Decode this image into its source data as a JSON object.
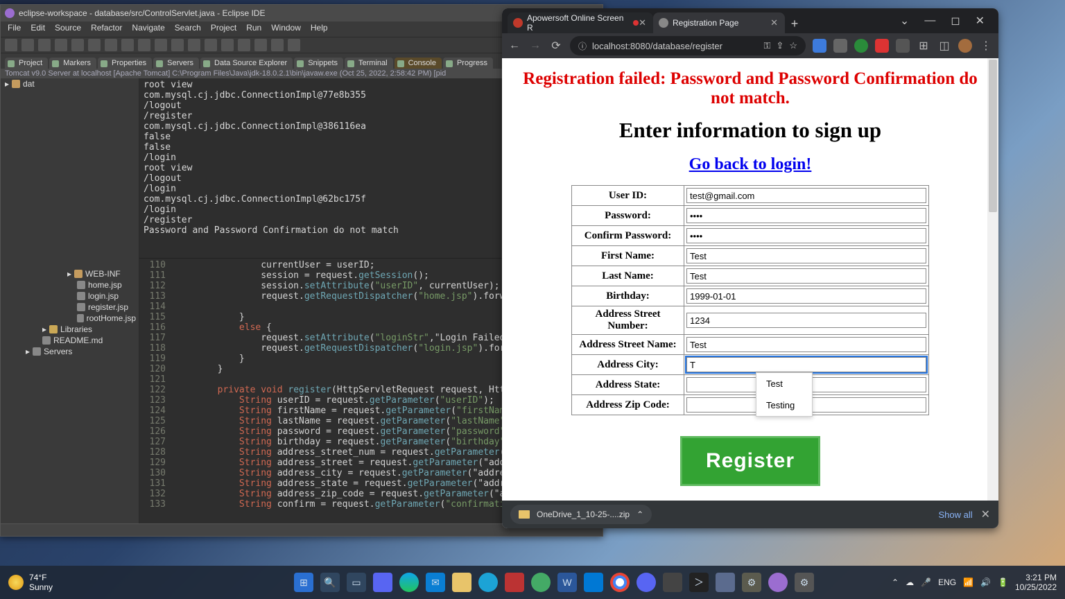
{
  "taskbar": {
    "weather_temp": "74°F",
    "weather_cond": "Sunny",
    "time": "3:21 PM",
    "date": "10/25/2022"
  },
  "eclipse": {
    "title": "eclipse-workspace - database/src/ControlServlet.java - Eclipse IDE",
    "menu": [
      "File",
      "Edit",
      "Source",
      "Refactor",
      "Navigate",
      "Search",
      "Project",
      "Run",
      "Window",
      "Help"
    ],
    "view_tabs": [
      "Project",
      "Markers",
      "Properties",
      "Servers",
      "Data Source Explorer",
      "Snippets",
      "Terminal",
      "Console",
      "Progress"
    ],
    "active_view_tab": "Console",
    "console_header": "Tomcat v9.0 Server at localhost [Apache Tomcat] C:\\Program Files\\Java\\jdk-18.0.2.1\\bin\\javaw.exe (Oct 25, 2022, 2:58:42 PM) [pid",
    "console_lines": [
      "root view",
      "com.mysql.cj.jdbc.ConnectionImpl@77e8b355",
      "/logout",
      "/register",
      "com.mysql.cj.jdbc.ConnectionImpl@386116ea",
      "false",
      "false",
      "/login",
      "root view",
      "/logout",
      "/login",
      "com.mysql.cj.jdbc.ConnectionImpl@62bc175f",
      "/login",
      "/register",
      "Password and Password Confirmation do not match"
    ],
    "explorer_top": [
      "dat"
    ],
    "explorer_files": [
      "WEB-INF",
      "home.jsp",
      "login.jsp",
      "register.jsp",
      "rootHome.jsp",
      "Libraries",
      "README.md",
      "Servers"
    ],
    "code_lines": [
      {
        "n": 110,
        "t": "                currentUser = userID;"
      },
      {
        "n": 111,
        "t": "                session = request.getSession();"
      },
      {
        "n": 112,
        "t": "                session.setAttribute(\"userID\", currentUser);"
      },
      {
        "n": 113,
        "t": "                request.getRequestDispatcher(\"home.jsp\").forwar"
      },
      {
        "n": 114,
        "t": ""
      },
      {
        "n": 115,
        "t": "            }"
      },
      {
        "n": 116,
        "t": "            else {"
      },
      {
        "n": 117,
        "t": "                request.setAttribute(\"loginStr\",\"Login Failed: "
      },
      {
        "n": 118,
        "t": "                request.getRequestDispatcher(\"login.jsp\").forwa"
      },
      {
        "n": 119,
        "t": "            }"
      },
      {
        "n": 120,
        "t": "        }"
      },
      {
        "n": 121,
        "t": ""
      },
      {
        "n": 122,
        "t": "        private void register(HttpServletRequest request, HttpSe"
      },
      {
        "n": 123,
        "t": "            String userID = request.getParameter(\"userID\");"
      },
      {
        "n": 124,
        "t": "            String firstName = request.getParameter(\"firstName\")"
      },
      {
        "n": 125,
        "t": "            String lastName = request.getParameter(\"lastName\");"
      },
      {
        "n": 126,
        "t": "            String password = request.getParameter(\"password\");"
      },
      {
        "n": 127,
        "t": "            String birthday = request.getParameter(\"birthday\");"
      },
      {
        "n": 128,
        "t": "            String address_street_num = request.getParameter(\"ad"
      },
      {
        "n": 129,
        "t": "            String address_street = request.getParameter(\"addres"
      },
      {
        "n": 130,
        "t": "            String address_city = request.getParameter(\"address_"
      },
      {
        "n": 131,
        "t": "            String address_state = request.getParameter(\"address"
      },
      {
        "n": 132,
        "t": "            String address_zip_code = request.getParameter(\"addr"
      },
      {
        "n": 133,
        "t": "            String confirm = request.getParameter(\"confirmation\""
      }
    ]
  },
  "chrome": {
    "tabs": [
      {
        "title": "Apowersoft Online Screen R",
        "active": false,
        "fav_color": "#c0392b",
        "recording": true
      },
      {
        "title": "Registration Page",
        "active": true,
        "fav_color": "#888"
      }
    ],
    "url": "localhost:8080/database/register",
    "page": {
      "error": "Registration failed: Password and Password Confirmation do not match.",
      "heading": "Enter information to sign up",
      "back_link": "Go back to login!",
      "fields": [
        {
          "label": "User ID:",
          "value": "test@gmail.com",
          "type": "text"
        },
        {
          "label": "Password:",
          "value": "••••",
          "type": "password"
        },
        {
          "label": "Confirm Password:",
          "value": "••••",
          "type": "password"
        },
        {
          "label": "First Name:",
          "value": "Test",
          "type": "text"
        },
        {
          "label": "Last Name:",
          "value": "Test",
          "type": "text"
        },
        {
          "label": "Birthday:",
          "value": "1999-01-01",
          "type": "text"
        },
        {
          "label": "Address Street Number:",
          "value": "1234",
          "type": "text"
        },
        {
          "label": "Address Street Name:",
          "value": "Test",
          "type": "text"
        },
        {
          "label": "Address City:",
          "value": "T",
          "type": "text",
          "focus": true
        },
        {
          "label": "Address State:",
          "value": "",
          "type": "text"
        },
        {
          "label": "Address Zip Code:",
          "value": "",
          "type": "text"
        }
      ],
      "autocomplete": [
        "Test",
        "Testing"
      ],
      "register_label": "Register"
    },
    "download": {
      "name": "OneDrive_1_10-25-....zip",
      "show_all": "Show all"
    }
  }
}
